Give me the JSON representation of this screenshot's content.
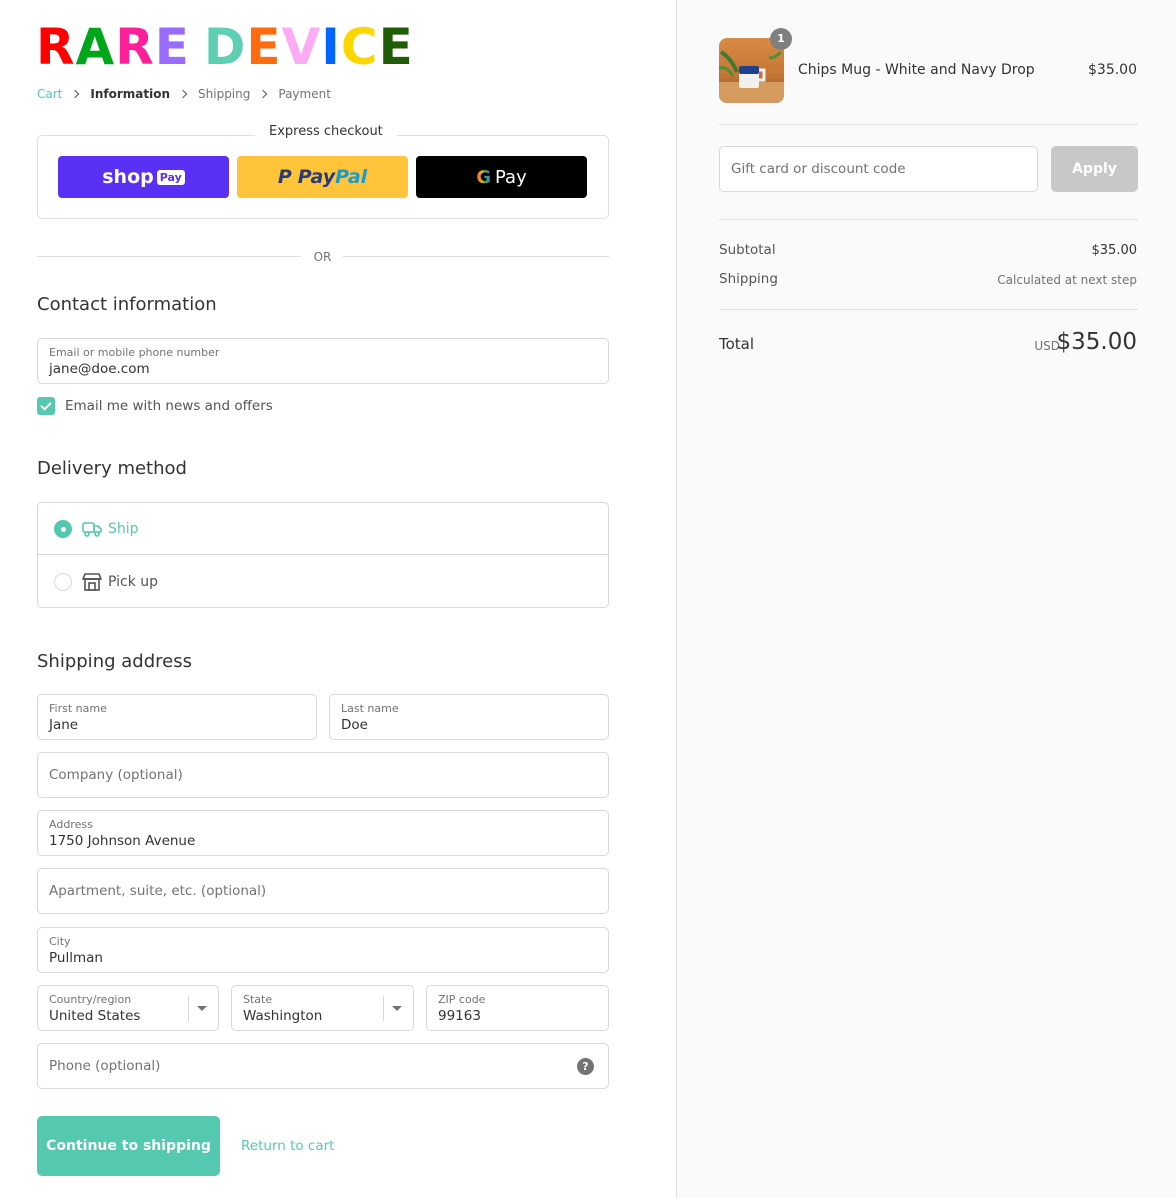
{
  "brand": {
    "letters": [
      {
        "ch": "R",
        "color": "#ff0000"
      },
      {
        "ch": "A",
        "color": "#00a619"
      },
      {
        "ch": "R",
        "color": "#ff1f9b"
      },
      {
        "ch": "E",
        "color": "#9a6bff"
      },
      {
        "ch": " ",
        "color": "#ffffff"
      },
      {
        "ch": "D",
        "color": "#5ccfb5"
      },
      {
        "ch": "E",
        "color": "#ff6b0d"
      },
      {
        "ch": "V",
        "color": "#ffaaf5"
      },
      {
        "ch": "I",
        "color": "#0066ff"
      },
      {
        "ch": "C",
        "color": "#ffd600"
      },
      {
        "ch": "E",
        "color": "#1f5c05"
      }
    ]
  },
  "breadcrumb": [
    {
      "label": "Cart",
      "state": "link"
    },
    {
      "label": "Information",
      "state": "active"
    },
    {
      "label": "Shipping",
      "state": "inactive"
    },
    {
      "label": "Payment",
      "state": "inactive"
    }
  ],
  "express": {
    "title": "Express checkout",
    "shop_pay": {
      "word": "shop",
      "badge": "Pay"
    },
    "paypal": {
      "part1": "Pay",
      "part2": "Pal",
      "p": "P"
    },
    "gpay": {
      "g": "G",
      "label": "Pay"
    }
  },
  "divider_or": "OR",
  "contact": {
    "heading": "Contact information",
    "email_label": "Email or mobile phone number",
    "email_value": "jane@doe.com",
    "newsletter_label": "Email me with news and offers",
    "newsletter_checked": true
  },
  "delivery": {
    "heading": "Delivery method",
    "options": [
      {
        "label": "Ship",
        "selected": true,
        "icon": "truck-icon"
      },
      {
        "label": "Pick up",
        "selected": false,
        "icon": "store-icon"
      }
    ]
  },
  "shipping": {
    "heading": "Shipping address",
    "first_name": {
      "label": "First name",
      "value": "Jane"
    },
    "last_name": {
      "label": "Last name",
      "value": "Doe"
    },
    "company": {
      "placeholder": "Company (optional)"
    },
    "address": {
      "label": "Address",
      "value": "1750 Johnson Avenue"
    },
    "apartment": {
      "placeholder": "Apartment, suite, etc. (optional)"
    },
    "city": {
      "label": "City",
      "value": "Pullman"
    },
    "country": {
      "label": "Country/region",
      "value": "United States"
    },
    "state": {
      "label": "State",
      "value": "Washington"
    },
    "zip": {
      "label": "ZIP code",
      "value": "99163"
    },
    "phone": {
      "placeholder": "Phone (optional)",
      "help": "?"
    }
  },
  "actions": {
    "continue": "Continue to shipping",
    "return": "Return to cart"
  },
  "summary": {
    "item": {
      "name": "Chips Mug - White and Navy Drop",
      "price": "$35.00",
      "quantity": "1"
    },
    "discount_placeholder": "Gift card or discount code",
    "apply": "Apply",
    "subtotal_label": "Subtotal",
    "subtotal_value": "$35.00",
    "shipping_label": "Shipping",
    "shipping_value": "Calculated at next step",
    "total_label": "Total",
    "currency": "USD",
    "total_value": "$35.00"
  },
  "colors": {
    "accent": "#54c9af",
    "shop_pay": "#5a31f4",
    "paypal": "#ffc439",
    "gpay": "#000000",
    "apply_disabled": "#c8c8c8"
  }
}
